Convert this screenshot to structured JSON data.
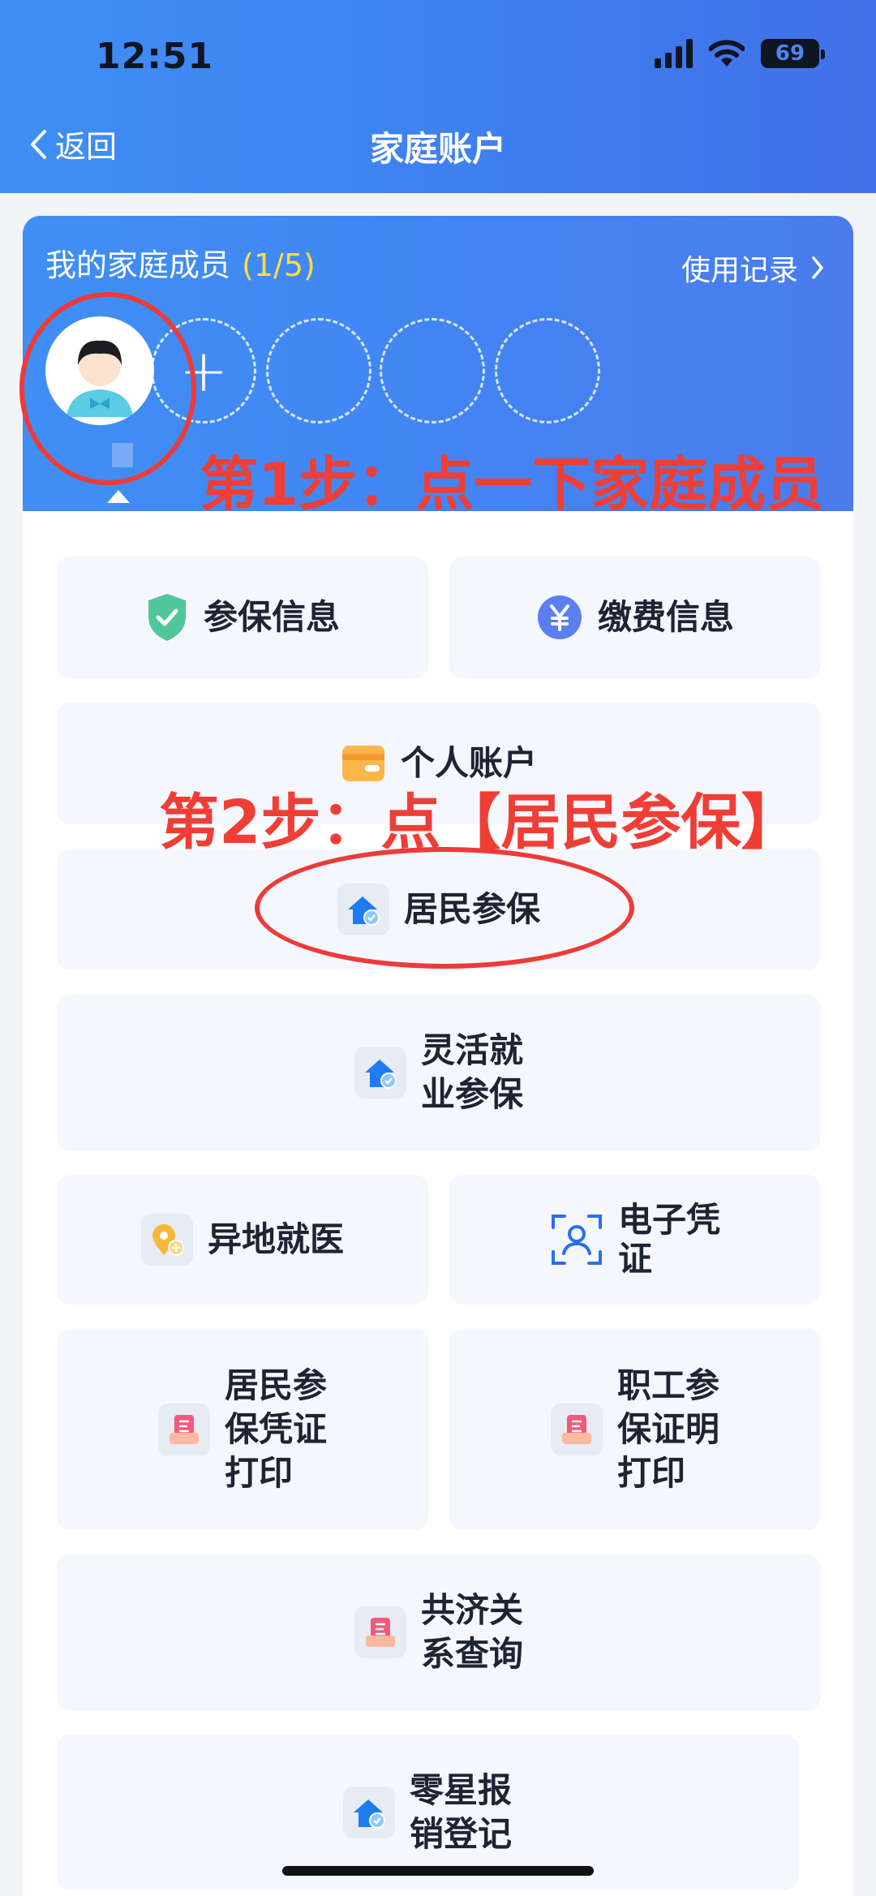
{
  "status_bar": {
    "time": "12:51",
    "battery": "69"
  },
  "nav": {
    "back_label": "返回",
    "title": "家庭账户"
  },
  "family": {
    "title": "我的家庭成员",
    "count": "(1/5)",
    "usage_label": "使用记录",
    "add_symbol": "+"
  },
  "menu": {
    "insurance_info": "参保信息",
    "payment_info": "缴费信息",
    "personal_account": "个人账户",
    "resident_insurance": "居民参保",
    "flexible_insurance": [
      "灵活就",
      "业参保"
    ],
    "remote_medical": "异地就医",
    "e_voucher": [
      "电子凭",
      "证"
    ],
    "resident_print": [
      "居民参",
      "保凭证",
      "打印"
    ],
    "employee_print": [
      "职工参",
      "保证明",
      "打印"
    ],
    "mutual_aid": [
      "共济关",
      "系查询"
    ],
    "reimbursement": [
      "零星报",
      "销登记"
    ]
  },
  "annotations": {
    "step1": "第1步：点一下家庭成员",
    "step2": "第2步：点【居民参保】"
  },
  "colors": {
    "header_blue": "#3f8ff5",
    "annotation_red": "#ef3e36",
    "tile_bg": "#f4f7fd"
  }
}
